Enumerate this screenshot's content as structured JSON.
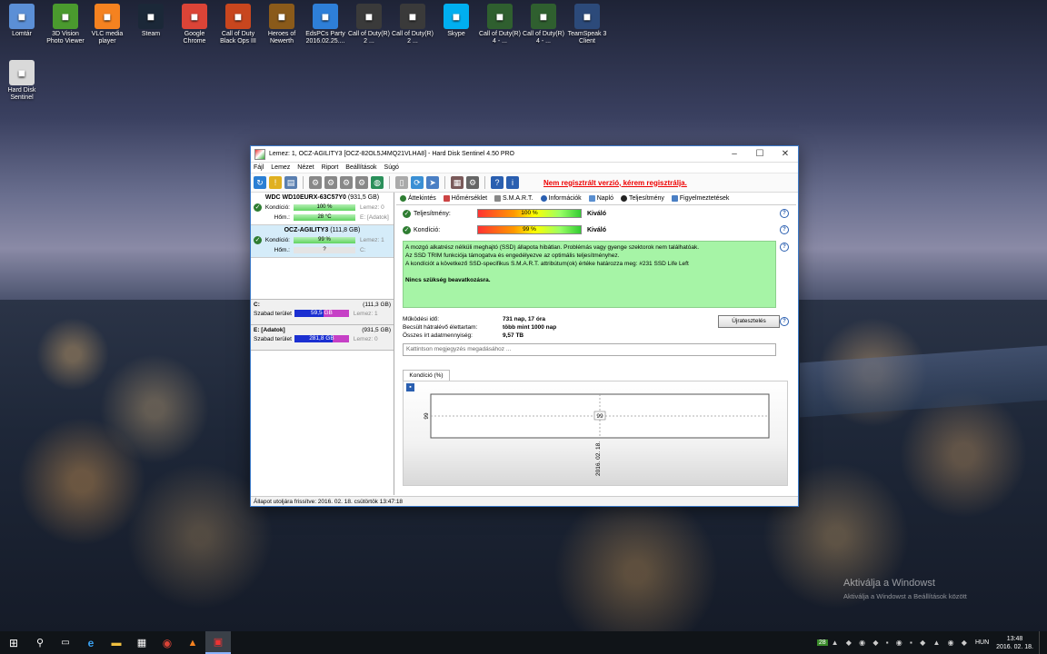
{
  "desktop_icons": [
    {
      "label": "Lomtár",
      "icon": "recycle-bin-icon",
      "color": "#5b8fd6"
    },
    {
      "label": "3D Vision Photo Viewer",
      "icon": "nvidia-3d-vision-icon",
      "color": "#4a9a2e"
    },
    {
      "label": "VLC media player",
      "icon": "vlc-icon",
      "color": "#f58220"
    },
    {
      "label": "Steam",
      "icon": "steam-icon",
      "color": "#1b2838"
    },
    {
      "label": "Google Chrome",
      "icon": "chrome-icon",
      "color": "#db4437"
    },
    {
      "label": "Call of Duty Black Ops III",
      "icon": "cod-bo3-icon",
      "color": "#c8461e"
    },
    {
      "label": "Heroes of Newerth",
      "icon": "hon-icon",
      "color": "#8a5a1a"
    },
    {
      "label": "EdsPCs Party 2016.02.25....",
      "icon": "document-icon",
      "color": "#2e7fd8"
    },
    {
      "label": "Call of Duty(R) 2 ...",
      "icon": "cod2-icon",
      "color": "#3a3a3a"
    },
    {
      "label": "Call of Duty(R) 2 ...",
      "icon": "cod2-icon",
      "color": "#3a3a3a"
    },
    {
      "label": "Skype",
      "icon": "skype-icon",
      "color": "#00aff0"
    },
    {
      "label": "Call of Duty(R) 4 - ...",
      "icon": "cod4-icon",
      "color": "#2f5f2f"
    },
    {
      "label": "Call of Duty(R) 4 - ...",
      "icon": "cod4-icon",
      "color": "#2f5f2f"
    },
    {
      "label": "TeamSpeak 3 Client",
      "icon": "teamspeak-icon",
      "color": "#2c4a7a"
    },
    {
      "label": "Hard Disk Sentinel",
      "icon": "hard-disk-sentinel-icon",
      "color": "#d9d9d9"
    }
  ],
  "window": {
    "title": "Lemez: 1, OCZ-AGILITY3 [OCZ-82OL5J4MQ21VLHA8]  -  Hard Disk Sentinel 4.50 PRO",
    "menu": [
      "Fájl",
      "Lemez",
      "Nézet",
      "Riport",
      "Beállítások",
      "Súgó"
    ],
    "register_notice": "Nem regisztrált verzió, kérem regisztrálja."
  },
  "disks": [
    {
      "name": "WDC WD10EURX-63C57Y0",
      "size": "(931,5 GB)",
      "condition": "100 %",
      "condition_value": 100,
      "temp": "28 °C",
      "note1": "Lemez: 0",
      "note2": "E: [Adatok]",
      "selected": false
    },
    {
      "name": "OCZ-AGILITY3",
      "size": "(111,8 GB)",
      "condition": "99 %",
      "condition_value": 99,
      "temp": "?",
      "note1": "Lemez: 1",
      "note2": "C:",
      "selected": true
    }
  ],
  "labels": {
    "condition": "Kondíció:",
    "temp": "Hőm.:",
    "free_space": "Szabad terület",
    "performance": "Teljesítmény:",
    "condition_main": "Kondíció:",
    "excellent": "Kiváló",
    "uptime": "Működési idő:",
    "lifetime": "Becsült hátralévő élettartam:",
    "written": "Összes írt adatmennyiség:",
    "retest": "Újratesztelés",
    "chart_tab": "Kondíció  (%)"
  },
  "volumes": [
    {
      "name": "C:",
      "size": "(111,3 GB)",
      "free": "59,5 GB",
      "free_fraction": 0.53,
      "disk": "Lemez: 1"
    },
    {
      "name": "E: [Adatok]",
      "size": "(931,5 GB)",
      "free": "281,8 GB",
      "free_fraction": 0.7,
      "disk": "Lemez: 0"
    }
  ],
  "tabs": [
    "Áttekintés",
    "Hőmérséklet",
    "S.M.A.R.T.",
    "Információk",
    "Napló",
    "Teljesítmény",
    "Figyelmeztetések"
  ],
  "overview": {
    "performance": "100 %",
    "performance_value": 100,
    "condition": "99 %",
    "condition_value": 99,
    "description_lines": [
      "A mozgó alkatrész nélküli meghajtó (SSD) állapota hibátlan. Problémás vagy gyenge szektorok nem találhatóak.",
      "Az SSD TRIM funkciója támogatva és engedélyezve az optimális teljesítményhez.",
      "A kondíciót a következő SSD-specifikus S.M.A.R.T. attribútum(ok) értéke határozza meg:  #231 SSD Life Left"
    ],
    "verdict": "Nincs szükség beavatkozásra.",
    "uptime": "731 nap, 17 óra",
    "lifetime": "több mint 1000 nap",
    "written": "9,57 TB",
    "note_placeholder": "Kattintson megjegyzés megadásához ..."
  },
  "chart_data": {
    "type": "line",
    "x": [
      "2016. 02. 18."
    ],
    "values": [
      99
    ],
    "ylabel": "",
    "data_label": "99",
    "y_tick": "99"
  },
  "status_bar": "Állapot utoljára frissítve: 2016. 02. 18. csütörtök 13:47:18",
  "watermark": {
    "line1": "Aktiválja a Windowst",
    "line2": "Aktiválja a Windowst a Beállítások között"
  },
  "taskbar": {
    "time": "13:48",
    "date": "2016. 02. 18.",
    "language": "HUN",
    "tray_badge": "28"
  }
}
